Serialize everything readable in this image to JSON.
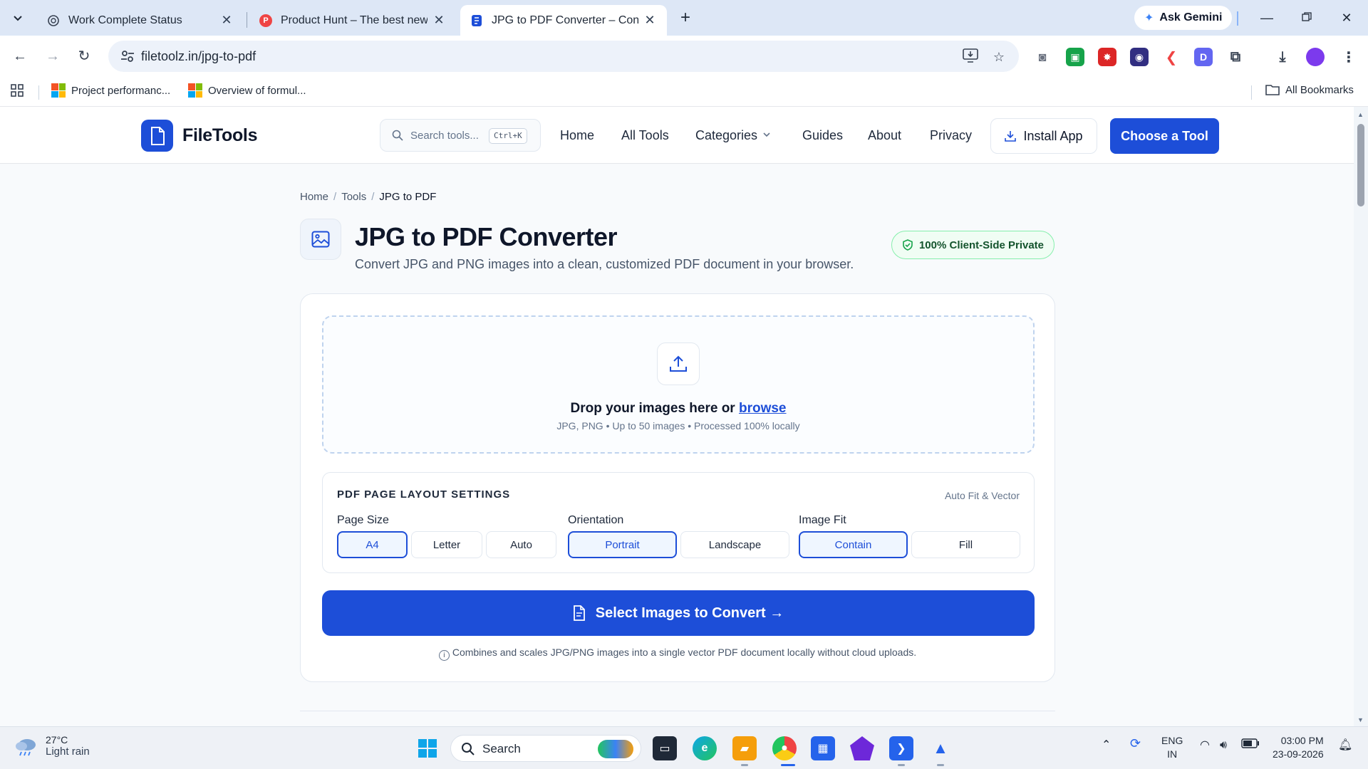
{
  "browser": {
    "tabs": [
      {
        "title": "Work Complete Status"
      },
      {
        "title": "Product Hunt – The best new products in tech"
      },
      {
        "title": "JPG to PDF Converter – Convert JPG to PDF"
      }
    ],
    "gemini_label": "Ask Gemini",
    "url": "filetoolz.in/jpg-to-pdf",
    "bookmarks": [
      {
        "label": "Project performanc..."
      },
      {
        "label": "Overview of formul..."
      }
    ],
    "all_bookmarks": "All Bookmarks"
  },
  "site": {
    "logo": "FileTools",
    "search_placeholder": "Search tools...",
    "search_shortcut": "Ctrl+K",
    "nav": {
      "home": "Home",
      "all_tools": "All Tools",
      "categories": "Categories",
      "guides": "Guides",
      "about": "About",
      "privacy": "Privacy"
    },
    "install_label": "Install App",
    "choose_label": "Choose a Tool"
  },
  "page": {
    "breadcrumb": [
      "Home",
      "Tools",
      "JPG to PDF"
    ],
    "title": "JPG to PDF Converter",
    "subtitle": "Convert JPG and PNG images into a clean, customized PDF document in your browser.",
    "privacy_badge": "100% Client-Side Private",
    "dropzone": {
      "title_prefix": "Drop your images here or ",
      "browse": "browse",
      "subtitle": "JPG, PNG • Up to 50 images • Processed 100% locally"
    },
    "settings": {
      "heading": "PDF PAGE LAYOUT SETTINGS",
      "tag": "Auto Fit & Vector",
      "page_size": {
        "label": "Page Size",
        "options": [
          "A4",
          "Letter",
          "Auto"
        ],
        "selected": "A4"
      },
      "orientation": {
        "label": "Orientation",
        "options": [
          "Portrait",
          "Landscape"
        ],
        "selected": "Portrait"
      },
      "image_fit": {
        "label": "Image Fit",
        "options": [
          "Contain",
          "Fill"
        ],
        "selected": "Contain"
      }
    },
    "convert_label": "Select Images to Convert →",
    "footnote": "Combines and scales JPG/PNG images into a single vector PDF document locally without cloud uploads."
  },
  "taskbar": {
    "temp": "27°C",
    "weather": "Light rain",
    "search_label": "Search",
    "lang1": "ENG",
    "lang2": "IN",
    "time": "03:00 PM",
    "date": "23-09-2026"
  },
  "colors": {
    "brand": "#1d4ed8",
    "success": "#16a34a"
  }
}
